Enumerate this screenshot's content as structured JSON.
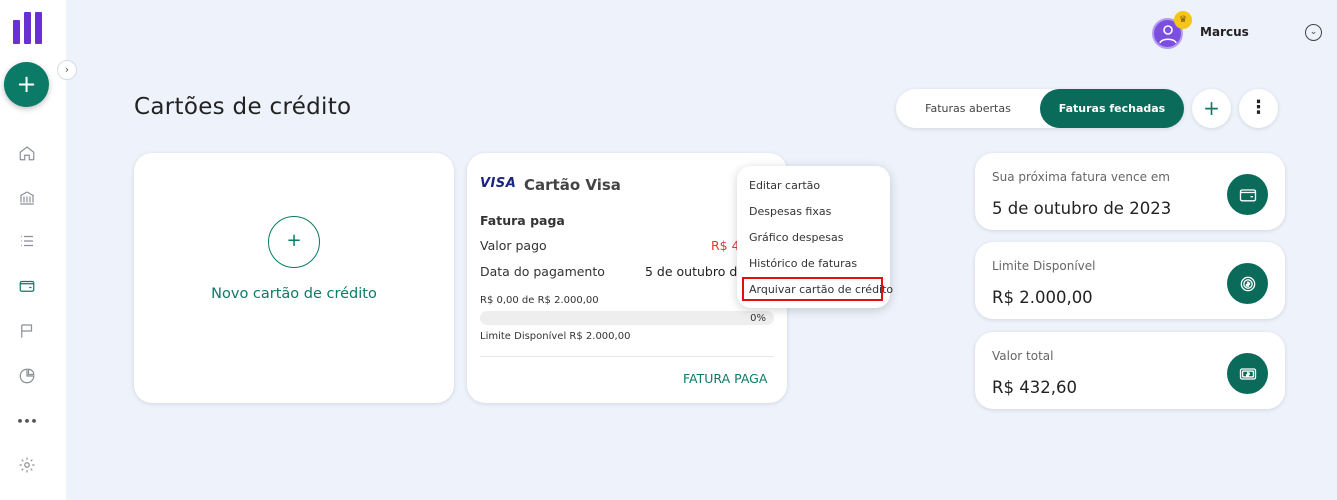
{
  "sidebar": {
    "fab_label": "+",
    "collapse_label": "›",
    "nav": [
      "home-icon",
      "bank-icon",
      "list-icon",
      "wallet-icon",
      "flag-icon",
      "pie-chart-icon",
      "more-icon",
      "gear-icon"
    ],
    "more_label": "•••"
  },
  "header": {
    "user_name": "Marcus",
    "chevron": "⌄",
    "crown": "♛"
  },
  "page": {
    "title": "Cartões de crédito"
  },
  "toolbar": {
    "tab_open": "Faturas abertas",
    "tab_closed": "Faturas fechadas",
    "add_label": "+",
    "more_label": "⋮"
  },
  "new_card": {
    "plus": "+",
    "label": "Novo cartão de crédito"
  },
  "credit_card": {
    "brand": "VISA",
    "name": "Cartão Visa",
    "status": "Fatura paga",
    "paid_label": "Valor pago",
    "paid_value": "R$ 4",
    "payment_date_label": "Data do pagamento",
    "payment_date_value": "5 de outubro de",
    "range_text": "R$ 0,00 de R$ 2.000,00",
    "percent": "0%",
    "percent_value": 0,
    "available_text": "Limite Disponível R$ 2.000,00",
    "footer_link": "FATURA PAGA"
  },
  "context_menu": {
    "items": [
      "Editar cartão",
      "Despesas fixas",
      "Gráfico despesas",
      "Histórico de faturas",
      "Arquivar cartão de crédito"
    ]
  },
  "summary": [
    {
      "label": "Sua próxima fatura vence em",
      "value": "5 de outubro de 2023",
      "icon": "wallet-icon"
    },
    {
      "label": "Limite Disponível",
      "value": "R$ 2.000,00",
      "icon": "coin-icon"
    },
    {
      "label": "Valor total",
      "value": "R$ 432,60",
      "icon": "cash-icon"
    }
  ],
  "colors": {
    "primary": "#0b7a66",
    "primary_dark": "#0b6b5a",
    "accent_purple": "#6b2fd6",
    "alert_red": "#e01010",
    "background": "#edf2fb"
  }
}
